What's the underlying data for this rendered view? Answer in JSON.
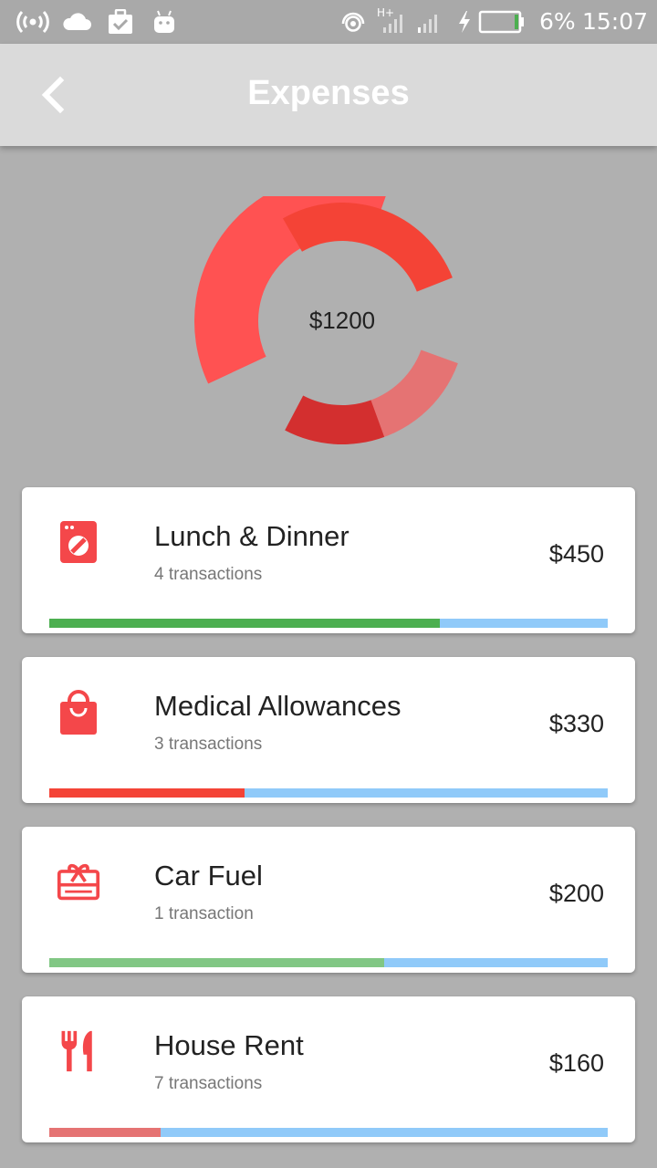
{
  "status_bar": {
    "battery_percent": "6%",
    "time": "15:07",
    "icons": [
      "hotspot-icon",
      "cloud-icon",
      "task-icon",
      "android-icon",
      "wifi-icon",
      "signal-icon",
      "charging-icon",
      "battery-icon"
    ]
  },
  "app_bar": {
    "title": "Expenses",
    "back_icon": "chevron-left-icon"
  },
  "chart_data": {
    "type": "pie",
    "total_label": "$1200",
    "values": [
      450,
      330,
      200,
      160
    ],
    "colors": [
      "#ff5252",
      "#f44336",
      "#e57373",
      "#d32f2f"
    ]
  },
  "expenses": [
    {
      "title": "Lunch & Dinner",
      "transactions": "4 transactions",
      "amount": "$450",
      "icon": "washing-machine-icon",
      "progress": 0.7,
      "bar_color": "#4caf50"
    },
    {
      "title": "Medical Allowances",
      "transactions": "3 transactions",
      "amount": "$330",
      "icon": "shopping-bag-icon",
      "progress": 0.35,
      "bar_color": "#f44336"
    },
    {
      "title": "Car Fuel",
      "transactions": "1 transaction",
      "amount": "$200",
      "icon": "gift-card-icon",
      "progress": 0.6,
      "bar_color": "#81c784"
    },
    {
      "title": "House Rent",
      "transactions": "7 transactions",
      "amount": "$160",
      "icon": "restaurant-icon",
      "progress": 0.2,
      "bar_color": "#e57373"
    }
  ],
  "accent": "#f44336"
}
